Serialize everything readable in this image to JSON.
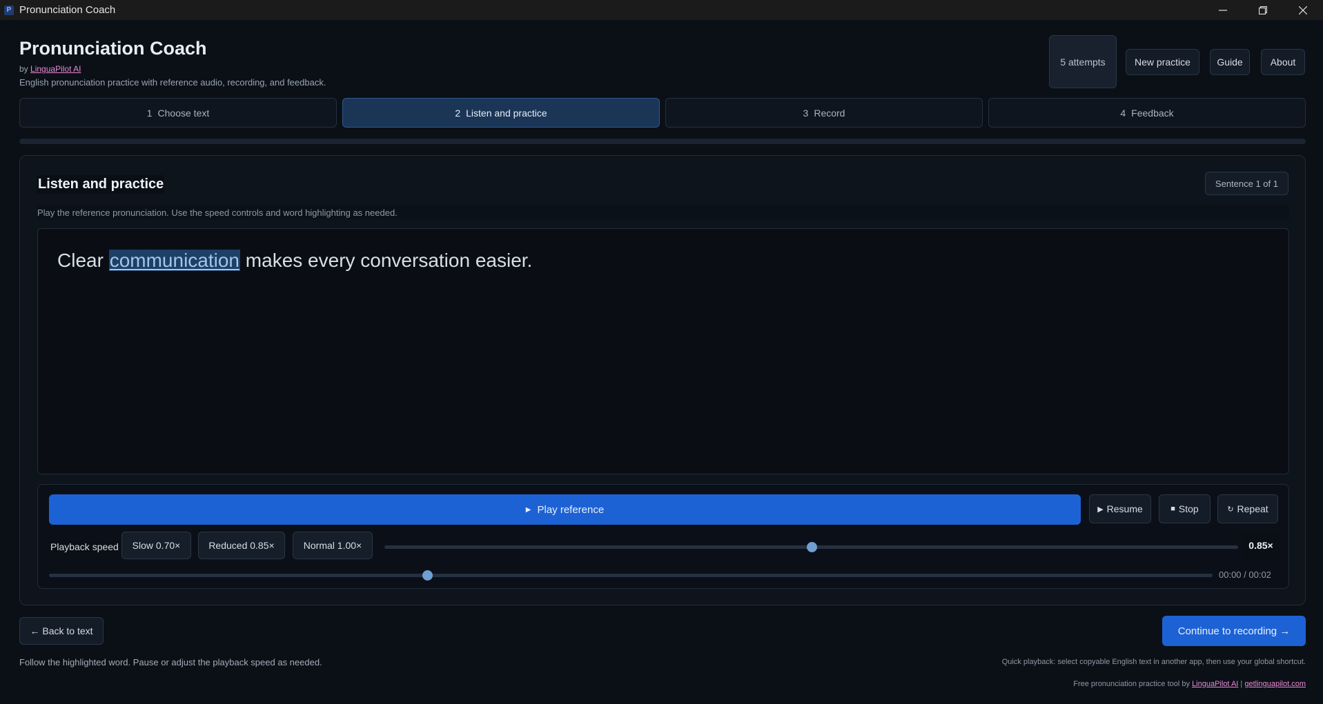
{
  "window": {
    "title": "Pronunciation Coach",
    "app_icon_letter": "P"
  },
  "header": {
    "title": "Pronunciation Coach",
    "by_prefix": "by",
    "by_link": "LinguaPilot AI",
    "subtitle": "English pronunciation practice with reference audio, recording, and feedback.",
    "attempts": "5 attempts",
    "new_practice": "New practice",
    "guide": "Guide",
    "about": "About"
  },
  "steps": [
    {
      "num": "1",
      "label": "Choose text",
      "active": false
    },
    {
      "num": "2",
      "label": "Listen and practice",
      "active": true
    },
    {
      "num": "3",
      "label": "Record",
      "active": false
    },
    {
      "num": "4",
      "label": "Feedback",
      "active": false
    }
  ],
  "card": {
    "title": "Listen and practice",
    "sentence_badge": "Sentence 1 of 1",
    "description": "Play the reference pronunciation. Use the speed controls and word highlighting as needed.",
    "sentence_before": "Clear ",
    "sentence_highlight": "communication",
    "sentence_after": " makes every conversation easier."
  },
  "controls": {
    "play": "Play reference",
    "resume": "Resume",
    "stop": "Stop",
    "repeat": "Repeat",
    "speed_label": "Playback speed",
    "slow": "Slow 0.70×",
    "reduced": "Reduced 0.85×",
    "normal": "Normal 1.00×",
    "speed_value": "0.85×",
    "speed_min": 0.5,
    "speed_max": 1.2,
    "speed_current": 0.85,
    "seek_fraction": 0.325,
    "time": "00:00 / 00:02"
  },
  "bottom": {
    "back": "← Back to text",
    "continue": "Continue to recording →",
    "hint": "Follow the highlighted word. Pause or adjust the playback speed as needed.",
    "quick": "Quick playback: select copyable English text in another app, then use your global shortcut.",
    "footer_prefix": "Free pronunciation practice tool by",
    "footer_link1": "LinguaPilot AI",
    "footer_sep": "|",
    "footer_link2": "getlinguapilot.com"
  },
  "colors": {
    "accent": "#1d62d4",
    "active_step": "#1b3557",
    "highlight": "#1e3f66",
    "link": "#e98ad4"
  }
}
